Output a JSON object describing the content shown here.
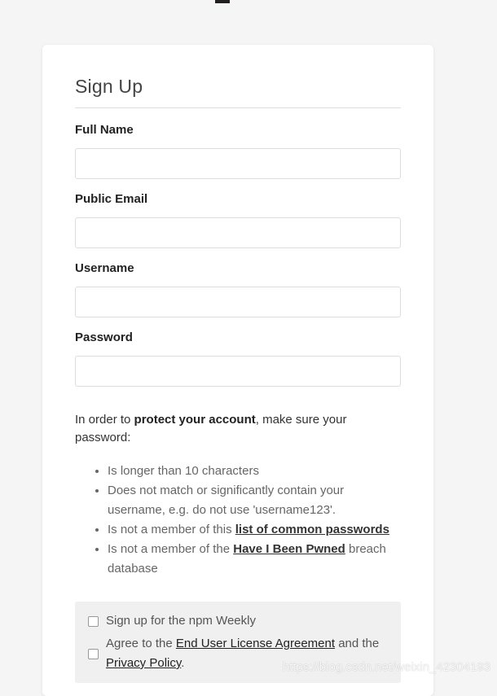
{
  "form": {
    "title": "Sign Up",
    "fields": [
      {
        "label": "Full Name",
        "value": "",
        "placeholder": ""
      },
      {
        "label": "Public Email",
        "value": "",
        "placeholder": ""
      },
      {
        "label": "Username",
        "value": "",
        "placeholder": ""
      },
      {
        "label": "Password",
        "value": "",
        "placeholder": ""
      }
    ]
  },
  "password_info": {
    "intro_prefix": "In order to ",
    "intro_bold": "protect your account",
    "intro_suffix": ", make sure your password:",
    "rules": {
      "r1": "Is longer than 10 characters",
      "r2": "Does not match or significantly contain your username, e.g. do not use 'username123'.",
      "r3_prefix": "Is not a member of this ",
      "r3_link": "list of common passwords",
      "r4_prefix": "Is not a member of the ",
      "r4_link": "Have I Been Pwned",
      "r4_suffix": " breach database"
    }
  },
  "consent": {
    "weekly_label": "Sign up for the npm Weekly",
    "agree_prefix": "Agree to the ",
    "eula_link": "End User License Agreement",
    "agree_middle": " and the",
    "privacy_link": "Privacy Policy",
    "agree_suffix": "."
  },
  "watermark": "https://blog.csdn.net/weixin_42304193",
  "colors": {
    "background": "#f5f5f5",
    "card": "#ffffff",
    "consent_box": "#f0f0f0",
    "logo": "#231f20"
  }
}
